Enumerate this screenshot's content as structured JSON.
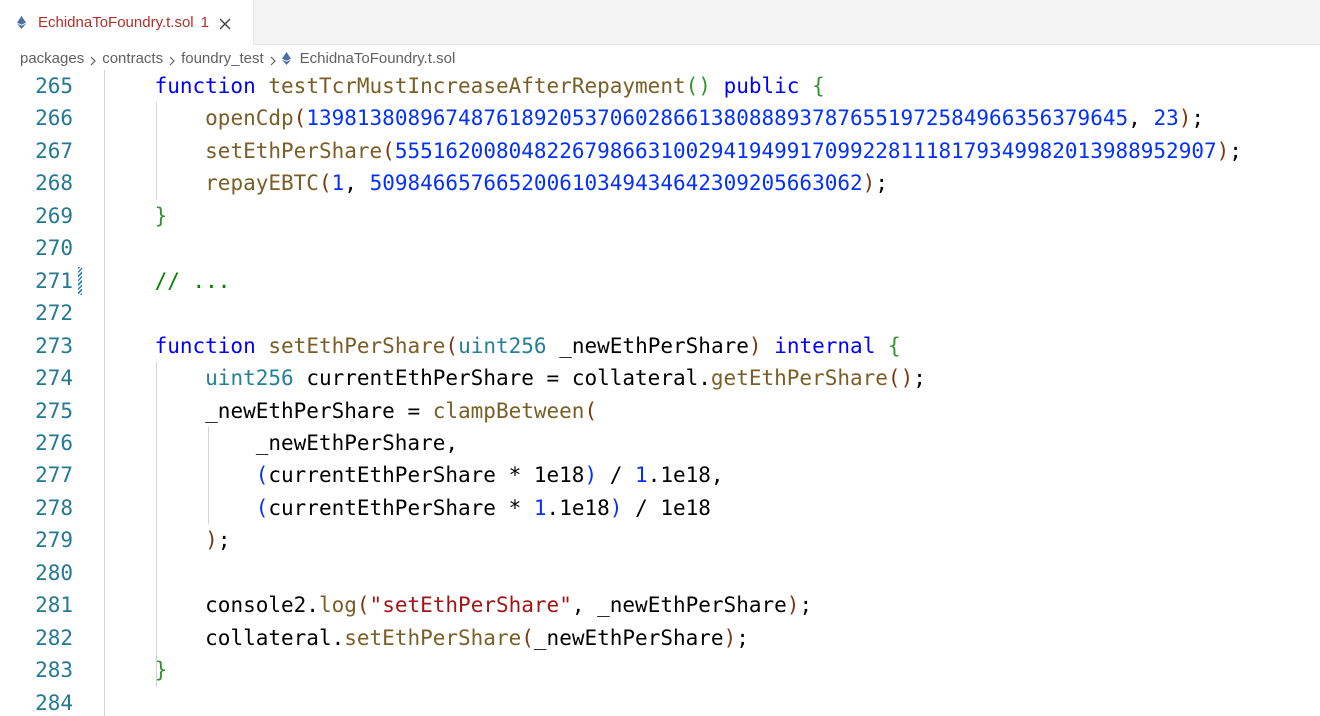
{
  "tab": {
    "label": "EchidnaToFoundry.t.sol",
    "problem_count": "1",
    "file_icon": "ethereum-icon",
    "icon_color": "#4a6fa5"
  },
  "breadcrumb": {
    "items": [
      "packages",
      "contracts",
      "foundry_test",
      "EchidnaToFoundry.t.sol"
    ]
  },
  "editor": {
    "lines": [
      {
        "number": "265",
        "tokens": [
          {
            "t": "    ",
            "c": ""
          },
          {
            "t": "function",
            "c": "kw"
          },
          {
            "t": " ",
            "c": ""
          },
          {
            "t": "testTcrMustIncreaseAfterRepayment",
            "c": "fn"
          },
          {
            "t": "()",
            "c": "br-b"
          },
          {
            "t": " ",
            "c": ""
          },
          {
            "t": "public",
            "c": "kw"
          },
          {
            "t": " ",
            "c": ""
          },
          {
            "t": "{",
            "c": "br-b"
          }
        ]
      },
      {
        "number": "266",
        "tokens": [
          {
            "t": "        ",
            "c": ""
          },
          {
            "t": "openCdp",
            "c": "fn"
          },
          {
            "t": "(",
            "c": "br-c"
          },
          {
            "t": "13981380896748761892053706028661380888937876551972584966356379645",
            "c": "num"
          },
          {
            "t": ", ",
            "c": ""
          },
          {
            "t": "23",
            "c": "num"
          },
          {
            "t": ")",
            "c": "br-c"
          },
          {
            "t": ";",
            "c": ""
          }
        ]
      },
      {
        "number": "267",
        "tokens": [
          {
            "t": "        ",
            "c": ""
          },
          {
            "t": "setEthPerShare",
            "c": "fn"
          },
          {
            "t": "(",
            "c": "br-c"
          },
          {
            "t": "55516200804822679866310029419499170992281118179349982013988952907",
            "c": "num"
          },
          {
            "t": ")",
            "c": "br-c"
          },
          {
            "t": ";",
            "c": ""
          }
        ]
      },
      {
        "number": "268",
        "tokens": [
          {
            "t": "        ",
            "c": ""
          },
          {
            "t": "repayEBTC",
            "c": "fn"
          },
          {
            "t": "(",
            "c": "br-c"
          },
          {
            "t": "1",
            "c": "num"
          },
          {
            "t": ", ",
            "c": ""
          },
          {
            "t": "50984665766520061034943464230920566306",
            "c": "num"
          },
          {
            "t": "2",
            "c": "num"
          },
          {
            "t": ")",
            "c": "br-c"
          },
          {
            "t": ";",
            "c": ""
          }
        ]
      },
      {
        "number": "269",
        "tokens": [
          {
            "t": "    ",
            "c": ""
          },
          {
            "t": "}",
            "c": "br-b"
          }
        ]
      },
      {
        "number": "270",
        "tokens": []
      },
      {
        "number": "271",
        "tokens": [
          {
            "t": "    ",
            "c": ""
          },
          {
            "t": "// ...",
            "c": "cmt"
          }
        ]
      },
      {
        "number": "272",
        "tokens": []
      },
      {
        "number": "273",
        "tokens": [
          {
            "t": "    ",
            "c": ""
          },
          {
            "t": "function",
            "c": "kw"
          },
          {
            "t": " ",
            "c": ""
          },
          {
            "t": "setEthPerShare",
            "c": "fn"
          },
          {
            "t": "(",
            "c": "br-c"
          },
          {
            "t": "uint256",
            "c": "typ"
          },
          {
            "t": " _newEthPerShare",
            "c": ""
          },
          {
            "t": ")",
            "c": "br-c"
          },
          {
            "t": " ",
            "c": ""
          },
          {
            "t": "internal",
            "c": "kw"
          },
          {
            "t": " ",
            "c": ""
          },
          {
            "t": "{",
            "c": "br-b"
          }
        ]
      },
      {
        "number": "274",
        "tokens": [
          {
            "t": "        ",
            "c": ""
          },
          {
            "t": "uint256",
            "c": "typ"
          },
          {
            "t": " currentEthPerShare = collateral.",
            "c": ""
          },
          {
            "t": "getEthPerShare",
            "c": "fn"
          },
          {
            "t": "()",
            "c": "br-c"
          },
          {
            "t": ";",
            "c": ""
          }
        ]
      },
      {
        "number": "275",
        "tokens": [
          {
            "t": "        ",
            "c": ""
          },
          {
            "t": "_newEthPerShare = ",
            "c": ""
          },
          {
            "t": "clampBetween",
            "c": "fn"
          },
          {
            "t": "(",
            "c": "br-c"
          }
        ]
      },
      {
        "number": "276",
        "tokens": [
          {
            "t": "            _newEthPerShare,",
            "c": ""
          }
        ]
      },
      {
        "number": "277",
        "tokens": [
          {
            "t": "            ",
            "c": ""
          },
          {
            "t": "(",
            "c": "br-a"
          },
          {
            "t": "currentEthPerShare * 1e18",
            "c": ""
          },
          {
            "t": ")",
            "c": "br-a"
          },
          {
            "t": " / ",
            "c": ""
          },
          {
            "t": "1",
            "c": "num"
          },
          {
            "t": ".1e18,",
            "c": ""
          }
        ]
      },
      {
        "number": "278",
        "tokens": [
          {
            "t": "            ",
            "c": ""
          },
          {
            "t": "(",
            "c": "br-a"
          },
          {
            "t": "currentEthPerShare * ",
            "c": ""
          },
          {
            "t": "1",
            "c": "num"
          },
          {
            "t": ".1e18",
            "c": ""
          },
          {
            "t": ")",
            "c": "br-a"
          },
          {
            "t": " / 1e18",
            "c": ""
          }
        ]
      },
      {
        "number": "279",
        "tokens": [
          {
            "t": "        ",
            "c": ""
          },
          {
            "t": ")",
            "c": "br-c"
          },
          {
            "t": ";",
            "c": ""
          }
        ]
      },
      {
        "number": "280",
        "tokens": []
      },
      {
        "number": "281",
        "tokens": [
          {
            "t": "        ",
            "c": ""
          },
          {
            "t": "console2.",
            "c": ""
          },
          {
            "t": "log",
            "c": "fn"
          },
          {
            "t": "(",
            "c": "br-c"
          },
          {
            "t": "\"setEthPerShare\"",
            "c": "str"
          },
          {
            "t": ", _newEthPerShare",
            "c": ""
          },
          {
            "t": ")",
            "c": "br-c"
          },
          {
            "t": ";",
            "c": ""
          }
        ]
      },
      {
        "number": "282",
        "tokens": [
          {
            "t": "        ",
            "c": ""
          },
          {
            "t": "collateral.",
            "c": ""
          },
          {
            "t": "setEthPerShare",
            "c": "fn"
          },
          {
            "t": "(",
            "c": "br-c"
          },
          {
            "t": "_newEthPerShare",
            "c": ""
          },
          {
            "t": ")",
            "c": "br-c"
          },
          {
            "t": ";",
            "c": ""
          }
        ]
      },
      {
        "number": "283",
        "tokens": [
          {
            "t": "    ",
            "c": ""
          },
          {
            "t": "}",
            "c": "br-b"
          }
        ]
      },
      {
        "number": "284",
        "tokens": []
      }
    ],
    "modified_line": "271"
  }
}
